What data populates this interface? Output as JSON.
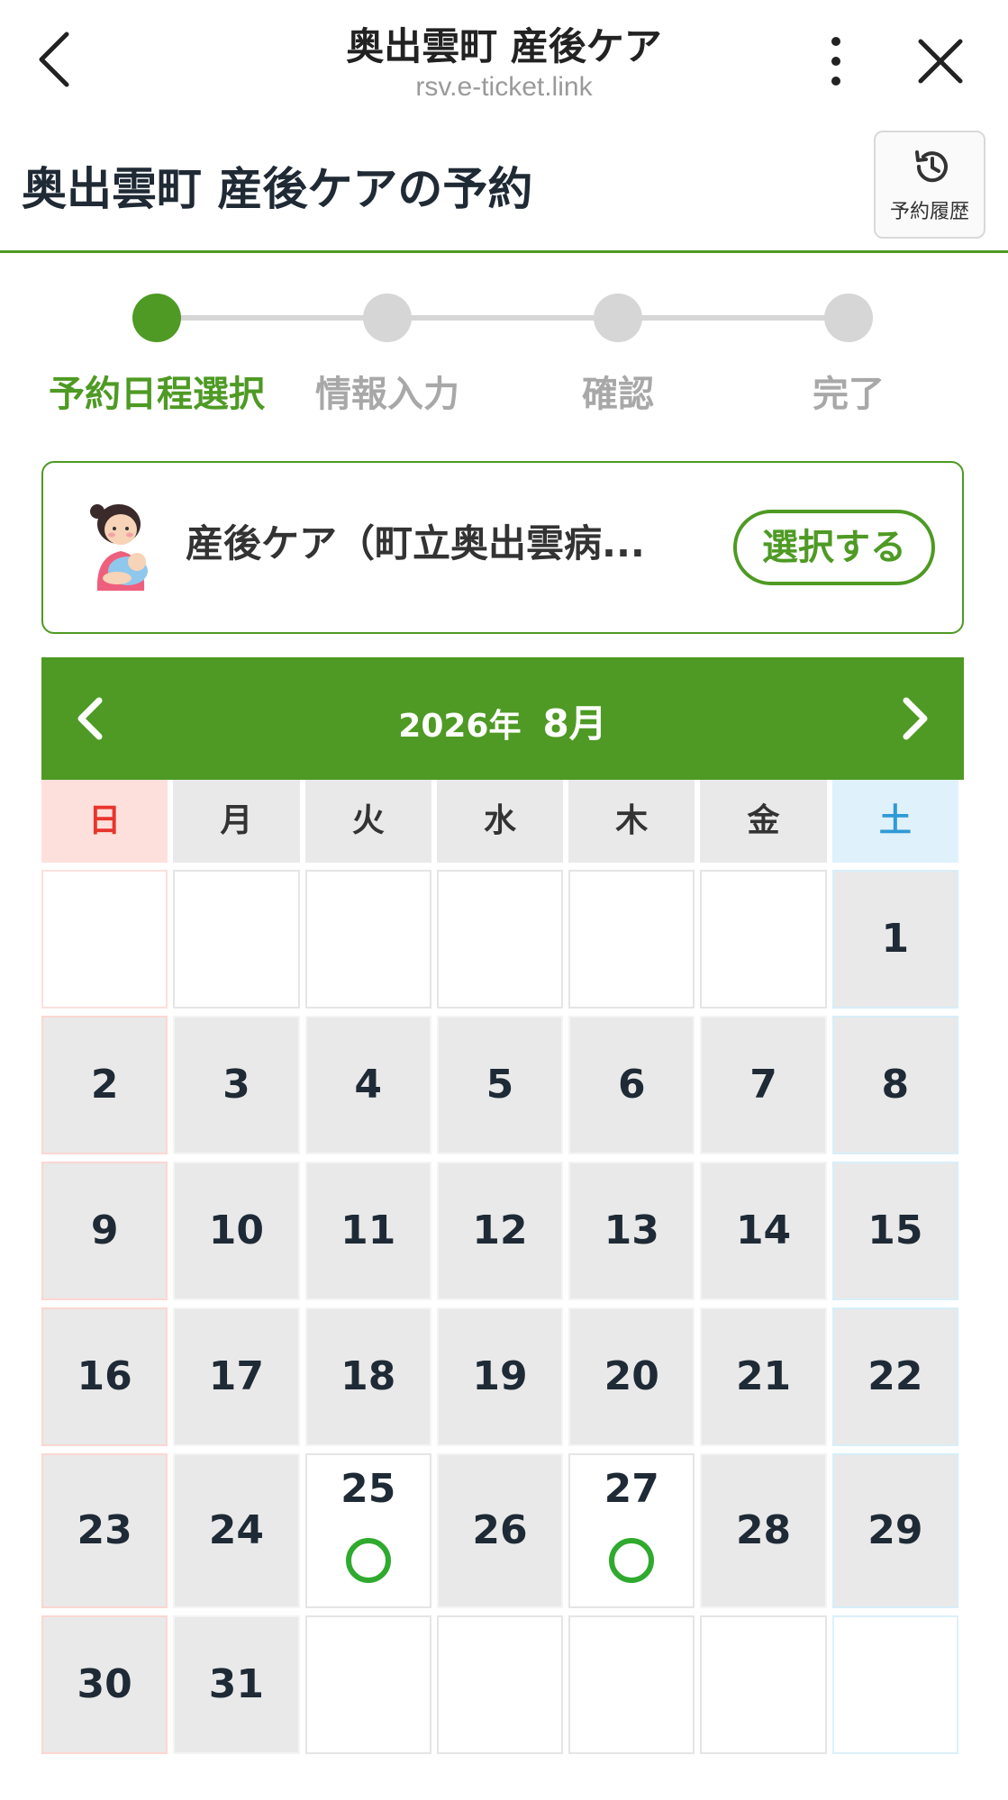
{
  "browser": {
    "title": "奥出雲町 産後ケア",
    "url": "rsv.e-ticket.link"
  },
  "header": {
    "title": "奥出雲町 産後ケアの予約",
    "history_label": "予約履歴"
  },
  "steps": [
    {
      "label": "予約日程選択",
      "active": true
    },
    {
      "label": "情報入力",
      "active": false
    },
    {
      "label": "確認",
      "active": false
    },
    {
      "label": "完了",
      "active": false
    }
  ],
  "service": {
    "name": "産後ケア（町立奥出雲病...",
    "select_label": "選択する"
  },
  "calendar": {
    "year_label": "2026年",
    "month_label": "8月",
    "weekdays": [
      "日",
      "月",
      "火",
      "水",
      "木",
      "金",
      "土"
    ],
    "rows": [
      [
        null,
        null,
        null,
        null,
        null,
        null,
        "1"
      ],
      [
        "2",
        "3",
        "4",
        "5",
        "6",
        "7",
        "8"
      ],
      [
        "9",
        "10",
        "11",
        "12",
        "13",
        "14",
        "15"
      ],
      [
        "16",
        "17",
        "18",
        "19",
        "20",
        "21",
        "22"
      ],
      [
        "23",
        "24",
        "25",
        "26",
        "27",
        "28",
        "29"
      ],
      [
        "30",
        "31",
        null,
        null,
        null,
        null,
        null
      ]
    ],
    "available_days": [
      "25",
      "27"
    ],
    "available_mark": "○"
  },
  "colors": {
    "accent": "#4e9a24",
    "sunday": "#e8352c",
    "saturday": "#2f9ad6",
    "available": "#2faa2f"
  }
}
